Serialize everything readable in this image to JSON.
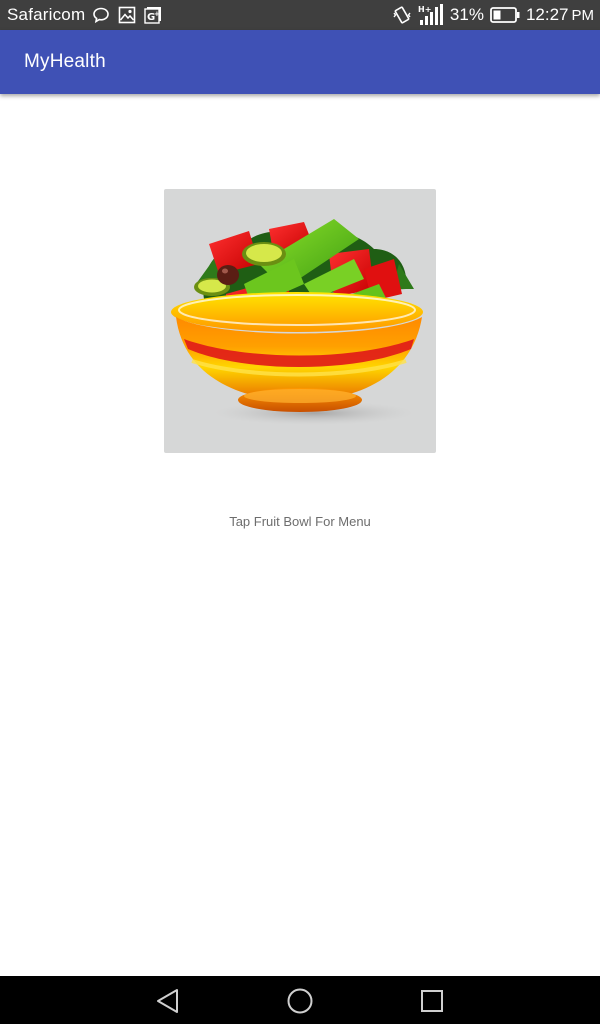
{
  "status_bar": {
    "carrier": "Safaricom",
    "network_type": "H+",
    "battery_percent": "31%",
    "time": "12:27",
    "time_suffix": "PM",
    "icons": [
      "chat-bubble-icon",
      "image-icon",
      "google-plus-icon",
      "vibrate-icon",
      "signal-icon",
      "battery-icon"
    ]
  },
  "app_bar": {
    "title": "MyHealth",
    "color": "#3f51b5"
  },
  "main": {
    "fruit_bowl": {
      "icon": "fruit-bowl-icon",
      "background": "#d6d7d7"
    },
    "hint": "Tap Fruit Bowl For Menu"
  },
  "nav_bar": {
    "buttons": [
      "back-icon",
      "home-icon",
      "recents-icon"
    ]
  }
}
